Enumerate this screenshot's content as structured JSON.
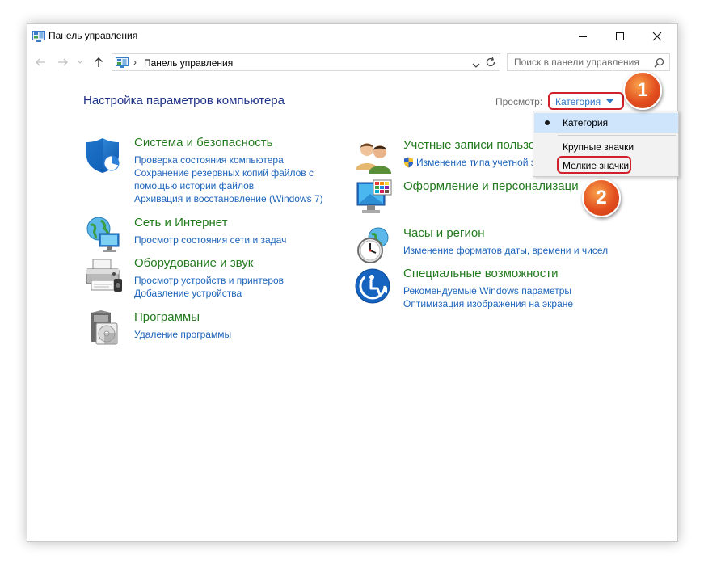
{
  "window": {
    "title": "Панель управления"
  },
  "address": {
    "separator": "›",
    "path": "Панель управления",
    "search_placeholder": "Поиск в панели управления"
  },
  "main": {
    "heading": "Настройка параметров компьютера",
    "view_by_label": "Просмотр:",
    "view_by_value": "Категория"
  },
  "categories": [
    {
      "title": "Система и безопасность",
      "icon": "shield-icon",
      "links": [
        "Проверка состояния компьютера",
        "Сохранение резервных копий файлов с",
        "помощью истории файлов",
        "Архивация и восстановление (Windows 7)"
      ]
    },
    {
      "title": "Сеть и Интернет",
      "icon": "network-globe-icon",
      "links": [
        "Просмотр состояния сети и задач"
      ]
    },
    {
      "title": "Оборудование и звук",
      "icon": "printer-icon",
      "links": [
        "Просмотр устройств и принтеров",
        "Добавление устройства"
      ]
    },
    {
      "title": "Программы",
      "icon": "programs-disk-icon",
      "links": [
        "Удаление программы"
      ]
    },
    {
      "title": "Учетные записи пользо",
      "icon": "users-icon",
      "links": [
        "Изменение типа учетной з"
      ]
    },
    {
      "title": "Оформление и персонализаци",
      "icon": "monitor-palette-icon",
      "links": []
    },
    {
      "title": "Часы и регион",
      "icon": "clock-globe-icon",
      "links": [
        "Изменение форматов даты, времени и чисел"
      ]
    },
    {
      "title": "Специальные возможности",
      "icon": "accessibility-icon",
      "links": [
        "Рекомендуемые Windows параметры",
        "Оптимизация изображения на экране"
      ]
    }
  ],
  "view_menu": {
    "items": [
      "Категория",
      "Крупные значки",
      "Мелкие значки"
    ],
    "selected": "Категория"
  },
  "badges": [
    "1",
    "2"
  ],
  "colors": {
    "heading": "#1e3287",
    "category_title": "#237a1e",
    "link": "#1d64ba",
    "highlight_red": "#d0202a",
    "badge_orange": "#e34e1f",
    "menu_selected": "#cfe5fb"
  }
}
